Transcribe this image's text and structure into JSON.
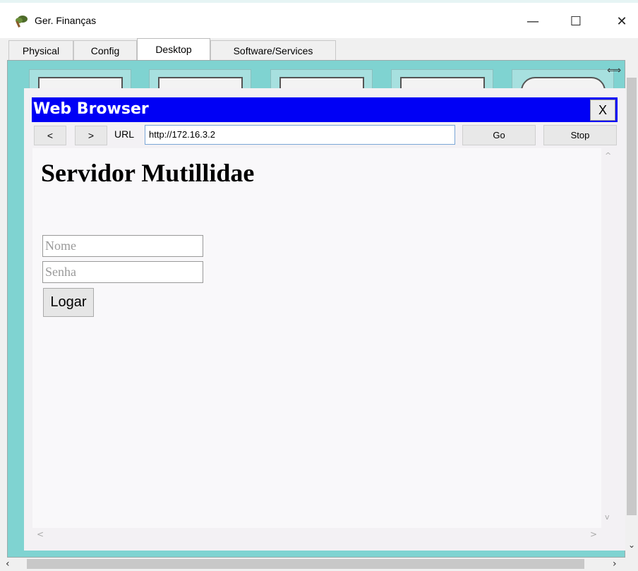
{
  "window": {
    "title": "Ger. Finanças",
    "controls": {
      "minimize": "—",
      "maximize": "☐",
      "close": "✕"
    }
  },
  "tabs": [
    {
      "label": "Physical",
      "active": false
    },
    {
      "label": "Config",
      "active": false
    },
    {
      "label": "Desktop",
      "active": true
    },
    {
      "label": "Software/Services",
      "active": false
    }
  ],
  "browser": {
    "title": "Web Browser",
    "close_label": "X",
    "back_label": "<",
    "forward_label": ">",
    "url_label": "URL",
    "url_value": "http://172.16.3.2",
    "go_label": "Go",
    "stop_label": "Stop"
  },
  "page": {
    "heading": "Servidor Mutillidae",
    "name_placeholder": "Nome",
    "password_placeholder": "Senha",
    "login_label": "Logar"
  },
  "colors": {
    "desktop_bg": "#7fd3d1",
    "browser_titlebar": "#0000f5"
  },
  "icons": {
    "app": "tree-icon",
    "resize": "resize-arrows-icon"
  }
}
